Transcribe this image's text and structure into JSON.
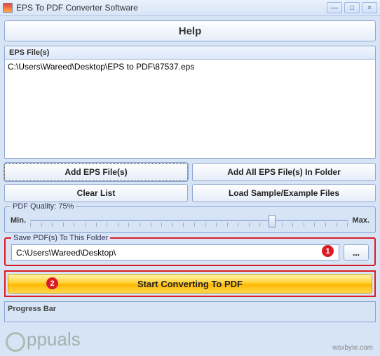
{
  "window": {
    "title": "EPS To PDF Converter Software",
    "minimize": "—",
    "maximize": "□",
    "close": "×"
  },
  "help_label": "Help",
  "files": {
    "header": "EPS File(s)",
    "items": [
      "C:\\Users\\Wareed\\Desktop\\EPS to PDF\\87537.eps"
    ]
  },
  "buttons": {
    "add_eps": "Add EPS File(s)",
    "add_folder": "Add All EPS File(s) In Folder",
    "clear": "Clear List",
    "load_sample": "Load Sample/Example Files",
    "browse": "...",
    "start": "Start Converting To PDF"
  },
  "quality": {
    "label": "PDF Quality: 75%",
    "min": "Min.",
    "max": "Max.",
    "percent": 75
  },
  "save": {
    "label": "Save PDF(s) To This Folder",
    "path": "C:\\Users\\Wareed\\Desktop\\"
  },
  "progress": {
    "label": "Progress Bar"
  },
  "markers": {
    "one": "1",
    "two": "2"
  },
  "watermark": "ppuals",
  "credit": "wsxbyte.com"
}
